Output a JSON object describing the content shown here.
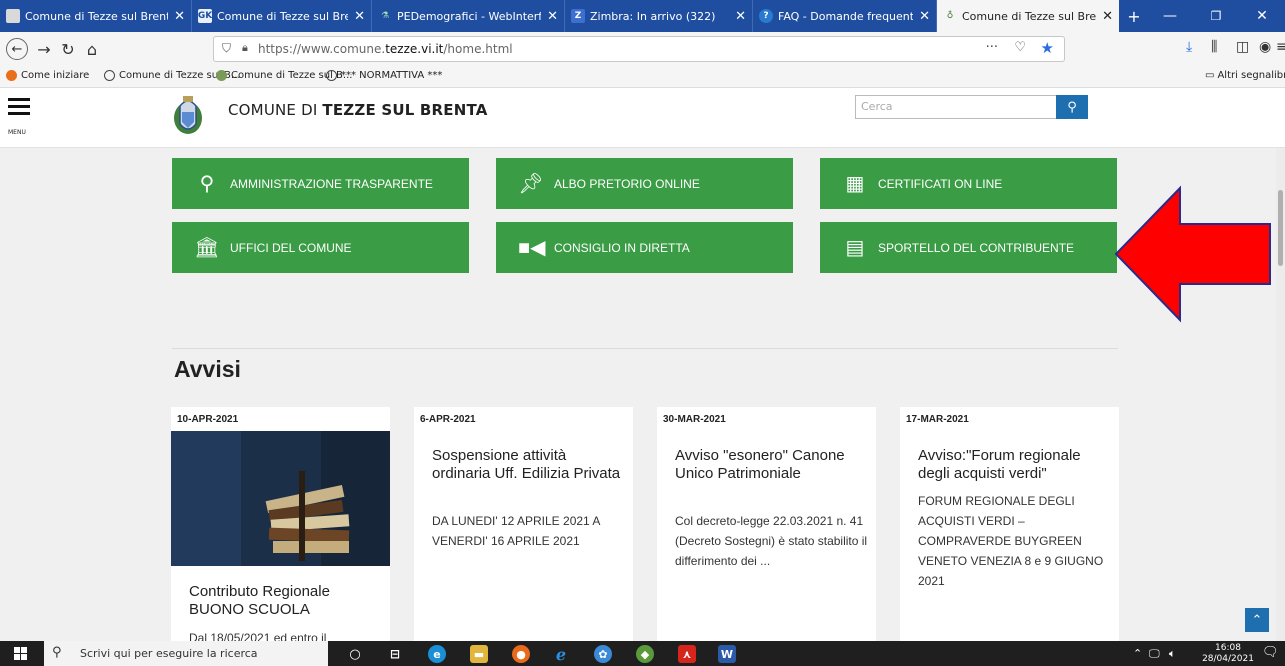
{
  "browser": {
    "tabs": [
      {
        "label": "Comune di Tezze sul Brenta - Log",
        "icon": "municipality-icon"
      },
      {
        "label": "Comune di Tezze sul Brenta - S",
        "icon": "gk-icon"
      },
      {
        "label": "PEDemografici - WebInterface",
        "icon": "ped-icon"
      },
      {
        "label": "Zimbra: In arrivo (322)",
        "icon": "zimbra-icon"
      },
      {
        "label": "FAQ - Domande frequenti | SP",
        "icon": "faq-icon"
      },
      {
        "label": "Comune di Tezze sul Brenta - (",
        "icon": "crest-icon"
      }
    ],
    "url_prefix": "https://www.comune.",
    "url_domain": "tezze.vi.it",
    "url_path": "/home.html",
    "bookmarks": [
      {
        "label": "Come iniziare"
      },
      {
        "label": "Comune di Tezze sul B..."
      },
      {
        "label": "Comune di Tezze sul B..."
      },
      {
        "label": "*** NORMATTIVA ***"
      }
    ],
    "other_bookmarks": "Altri segnalibri"
  },
  "site": {
    "menu_label": "MENU",
    "title_prefix": "COMUNE DI ",
    "title_bold": "TEZZE SUL BRENTA",
    "search_placeholder": "Cerca"
  },
  "quick_links": [
    {
      "label": "AMMINISTRAZIONE TRASPARENTE",
      "icon": "search-icon"
    },
    {
      "label": "ALBO PRETORIO ONLINE",
      "icon": "pin-icon"
    },
    {
      "label": "CERTIFICATI ON LINE",
      "icon": "qr-code-icon"
    },
    {
      "label": "UFFICI DEL COMUNE",
      "icon": "institution-icon"
    },
    {
      "label": "CONSIGLIO IN DIRETTA",
      "icon": "video-camera-icon"
    },
    {
      "label": "SPORTELLO DEL CONTRIBUENTE",
      "icon": "calculator-icon"
    }
  ],
  "notices": {
    "heading": "Avvisi",
    "items": [
      {
        "date": "10-APR-2021",
        "title": "Contributo Regionale BUONO SCUOLA",
        "body": "Dal 18/05/2021 ed entro il"
      },
      {
        "date": "6-APR-2021",
        "title": "Sospensione attività ordinaria Uff. Edilizia Privata",
        "body": "DA LUNEDI' 12 APRILE 2021 A VENERDI' 16 APRILE 2021"
      },
      {
        "date": "30-MAR-2021",
        "title": "Avviso \"esonero\" Canone Unico Patrimoniale",
        "body": "Col decreto-legge 22.03.2021 n. 41 (Decreto Sostegni) è stato stabilito il differimento dei ..."
      },
      {
        "date": "17-MAR-2021",
        "title": "Avviso:\"Forum regionale degli acquisti verdi\"",
        "body": "FORUM REGIONALE DEGLI ACQUISTI VERDI –COMPRAVERDE BUYGREEN VENETO VENEZIA 8 e 9 GIUGNO 2021"
      }
    ]
  },
  "taskbar": {
    "search_placeholder": "Scrivi qui per eseguire la ricerca",
    "time": "16:08",
    "date": "28/04/2021"
  },
  "colors": {
    "tab_bar": "#1f4ea0",
    "button_green": "#3a9c45",
    "accent_blue": "#1d6fb0",
    "annotation_red": "#ff0000"
  }
}
